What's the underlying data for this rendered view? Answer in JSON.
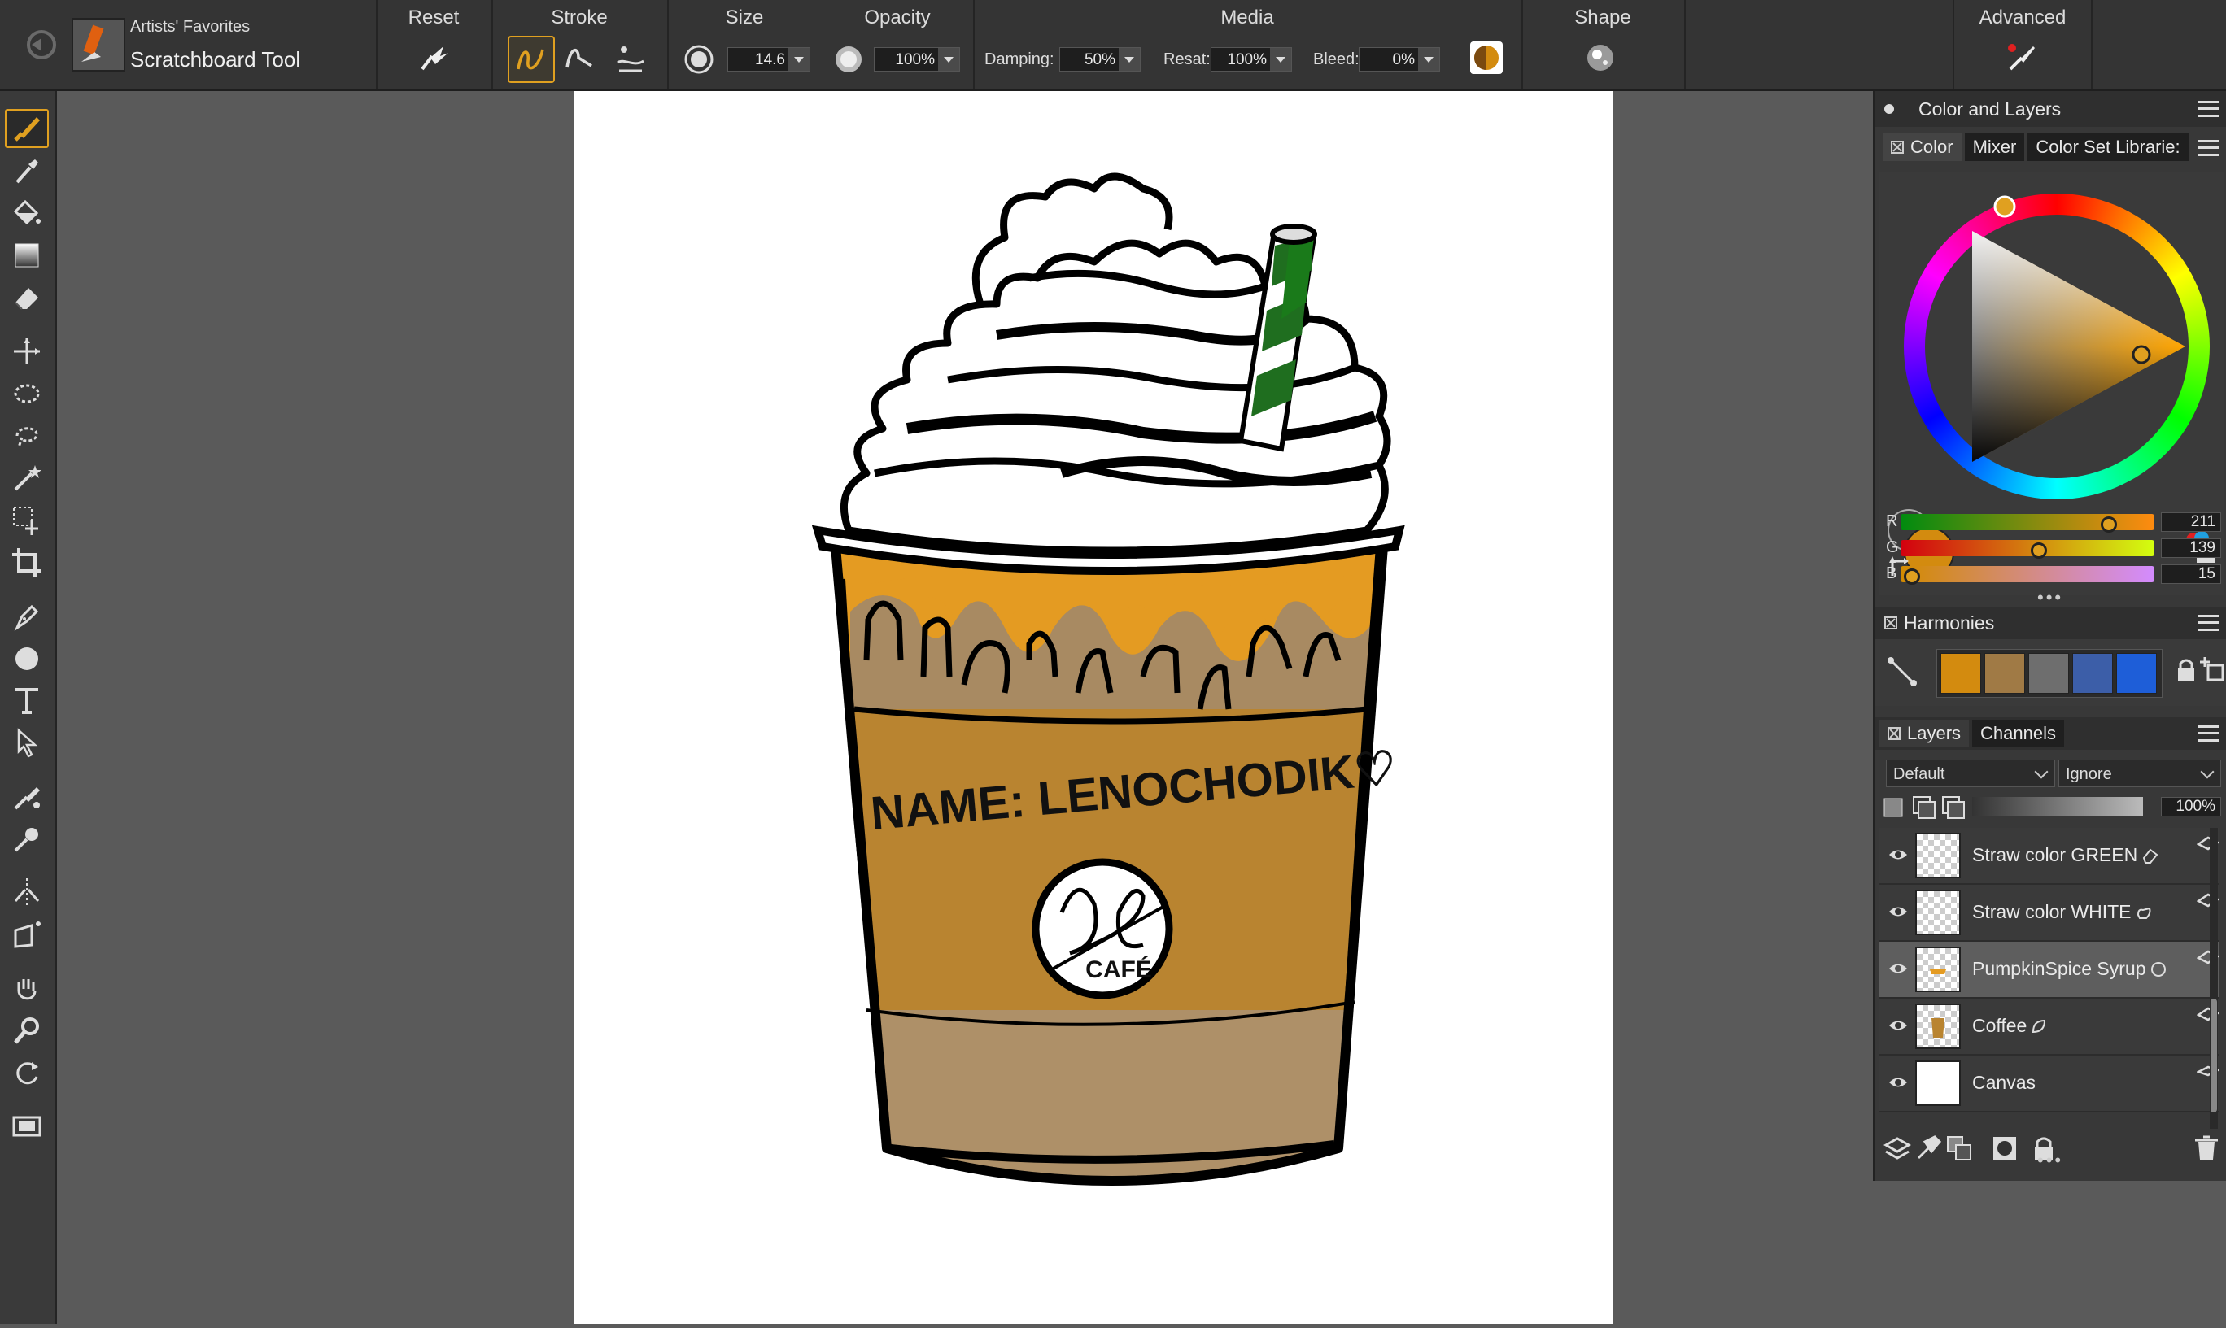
{
  "toolbar": {
    "brush_category": "Artists' Favorites",
    "brush_variant": "Scratchboard Tool",
    "reset_label": "Reset",
    "stroke_label": "Stroke",
    "size_label": "Size",
    "size_value": "14.6",
    "opacity_label": "Opacity",
    "opacity_value": "100%",
    "media_label": "Media",
    "damping_label": "Damping:",
    "damping_value": "50%",
    "resat_label": "Resat:",
    "resat_value": "100%",
    "bleed_label": "Bleed:",
    "bleed_value": "0%",
    "shape_label": "Shape",
    "advanced_label": "Advanced"
  },
  "tools": [
    "brush-tool-icon",
    "dropper-icon",
    "paint-bucket-icon",
    "gradient-icon",
    "eraser-icon",
    "transform-icon",
    "rect-selection-icon",
    "lasso-icon",
    "magic-wand-icon",
    "selection-adjuster-icon",
    "crop-icon",
    "pen-icon",
    "shape-circle-icon",
    "text-icon",
    "shape-selector-icon",
    "cloner-icon",
    "rubber-stamp-icon",
    "mirror-icon",
    "perspective-grid-icon",
    "grabber-icon",
    "magnifier-icon",
    "rotate-page-icon",
    "screen-mode-icon"
  ],
  "color_panel": {
    "header": "Color and Layers",
    "tabs": [
      "Color",
      "Mixer",
      "Color Set Librarie:"
    ],
    "main_color": "#D38B0F",
    "r_label": "R",
    "r_value": "211",
    "g_label": "G",
    "g_value": "139",
    "b_label": "B",
    "b_value": "15"
  },
  "harmonies": {
    "title": "Harmonies",
    "swatches": [
      "#D38B0F",
      "#A07A45",
      "#6E6E6E",
      "#3C5EA8",
      "#1E5ED8"
    ]
  },
  "layers_panel": {
    "tabs": [
      "Layers",
      "Channels"
    ],
    "composite_method": "Default",
    "preserve": "Ignore",
    "opacity": "100%",
    "layers": [
      {
        "name": "Straw color GREEN"
      },
      {
        "name": "Straw color WHITE"
      },
      {
        "name": "PumpkinSpice Syrup"
      },
      {
        "name": "Coffee"
      },
      {
        "name": "Canvas"
      }
    ]
  },
  "artwork": {
    "cup_text": "NAME: LENOCHODIK♡",
    "logo_text": "CAFÉ"
  }
}
